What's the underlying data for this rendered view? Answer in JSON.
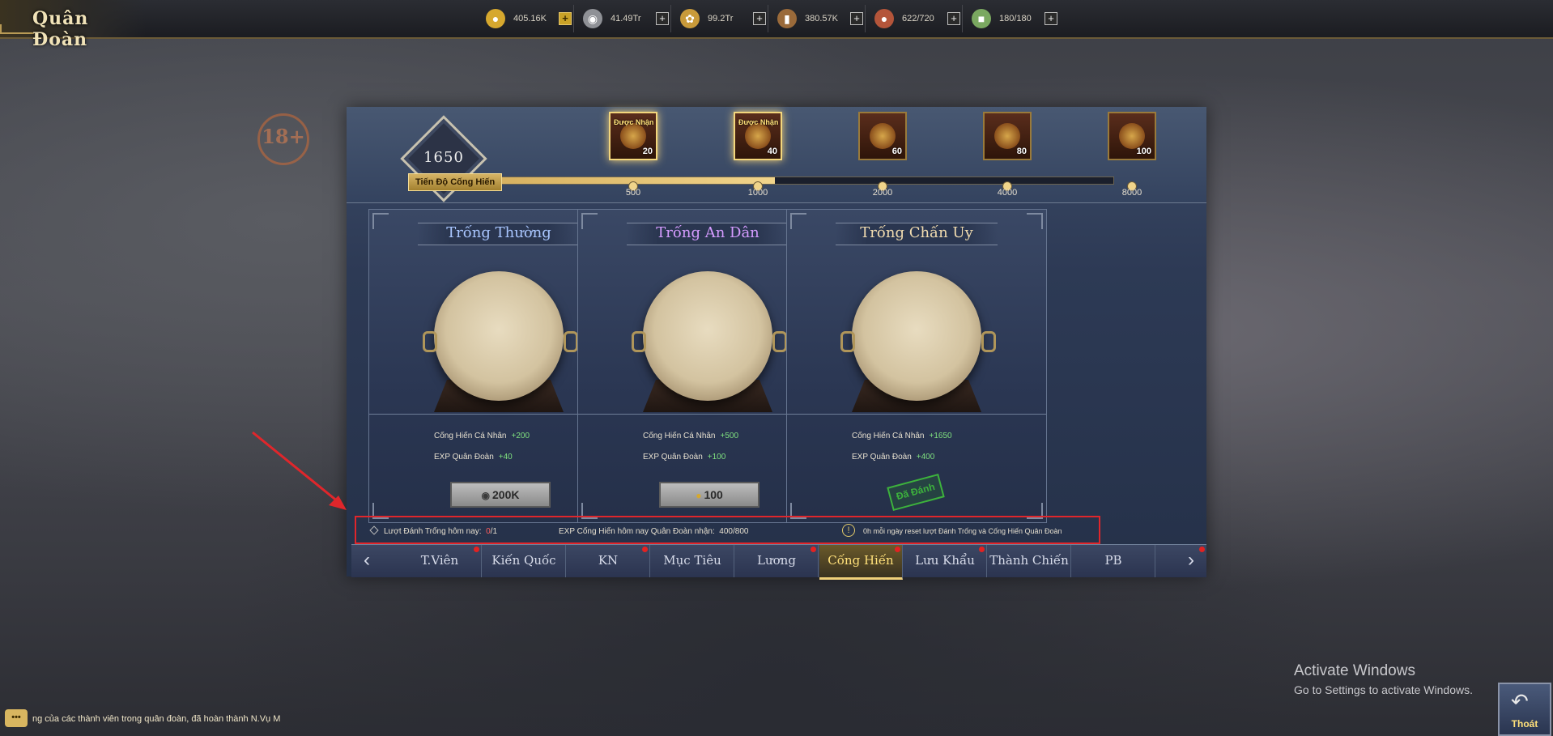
{
  "window": {
    "title": "Quân Đoàn"
  },
  "resources": [
    {
      "icon": "gold-ingot-icon",
      "value": "405.16K",
      "plus_style": "gold"
    },
    {
      "icon": "silver-coin-icon",
      "value": "41.49Tr",
      "plus_style": "normal"
    },
    {
      "icon": "wheat-icon",
      "value": "99.2Tr",
      "plus_style": "normal"
    },
    {
      "icon": "wood-icon",
      "value": "380.57K",
      "plus_style": "normal"
    },
    {
      "icon": "meat-icon",
      "value": "622/720",
      "plus_style": "normal"
    },
    {
      "icon": "stamina-scroll-icon",
      "value": "180/180",
      "plus_style": "normal"
    }
  ],
  "progress": {
    "current": "1650",
    "label": "Tiến Độ Cống Hiến",
    "fill_fraction": 0.45,
    "milestones": [
      {
        "threshold": "500",
        "count": "20",
        "tag": "Được Nhận",
        "claimable": true
      },
      {
        "threshold": "1000",
        "count": "40",
        "tag": "Được Nhận",
        "claimable": true
      },
      {
        "threshold": "2000",
        "count": "60",
        "tag": "",
        "claimable": false
      },
      {
        "threshold": "4000",
        "count": "80",
        "tag": "",
        "claimable": false
      },
      {
        "threshold": "8000",
        "count": "100",
        "tag": "",
        "claimable": false
      }
    ]
  },
  "drums": [
    {
      "title": "Trống Thường",
      "title_color": "#a9c6ff",
      "reward1_label": "Cống Hiến Cá Nhân",
      "reward1_value": "+200",
      "reward2_label": "EXP Quân Đoàn",
      "reward2_value": "+40",
      "cost": "200K",
      "cost_icon": "silver-coin-icon",
      "done": false
    },
    {
      "title": "Trống An Dân",
      "title_color": "#d59cff",
      "reward1_label": "Cống Hiến Cá Nhân",
      "reward1_value": "+500",
      "reward2_label": "EXP Quân Đoàn",
      "reward2_value": "+100",
      "cost": "100",
      "cost_icon": "gold-ingot-icon",
      "done": false
    },
    {
      "title": "Trống Chấn Uy",
      "title_color": "#f1dcb0",
      "reward1_label": "Cống Hiến Cá Nhân",
      "reward1_value": "+1650",
      "reward2_label": "EXP Quân Đoàn",
      "reward2_value": "+400",
      "cost": "",
      "done_label": "Đã Đánh",
      "done": true
    }
  ],
  "info": {
    "turns_label": "Lượt Đánh Trống hôm nay:",
    "turns_value_red": "0",
    "turns_value_rest": "/1",
    "exp_label": "EXP Cống Hiến hôm nay Quân Đoàn nhận:",
    "exp_value": "400/800",
    "reset_note": "0h mỗi ngày reset lượt Đánh Trống và Cống Hiến Quân Đoàn"
  },
  "tabs": [
    {
      "label": "T.Viên",
      "dot": true,
      "active": false
    },
    {
      "label": "Kiến Quốc",
      "dot": false,
      "active": false
    },
    {
      "label": "KN",
      "dot": true,
      "active": false
    },
    {
      "label": "Mục Tiêu",
      "dot": false,
      "active": false
    },
    {
      "label": "Lương",
      "dot": true,
      "active": false
    },
    {
      "label": "Cống Hiến",
      "dot": true,
      "active": true
    },
    {
      "label": "Lưu Khẩu",
      "dot": true,
      "active": false
    },
    {
      "label": "Thành Chiến",
      "dot": false,
      "active": false
    },
    {
      "label": "PB",
      "dot": false,
      "active": false
    }
  ],
  "watermark": {
    "line1": "Activate Windows",
    "line2": "Go to Settings to activate Windows."
  },
  "exit": {
    "label": "Thoát"
  },
  "chat": {
    "text": "ng của các thành viên trong quân đoàn, đã hoàn thành N.Vụ M"
  },
  "colors": {
    "accent": "#f1d07a",
    "highlight_border": "#e0262b",
    "bonus_green": "#7fe07f"
  }
}
